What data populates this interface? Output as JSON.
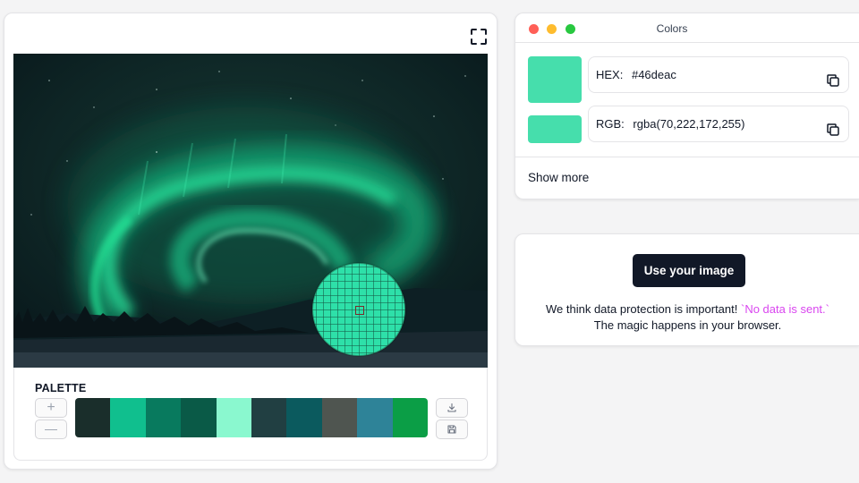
{
  "palette": {
    "title": "PALETTE",
    "add_label": "+",
    "remove_label": "—",
    "swatches": [
      "#1a2e2b",
      "#10bf8e",
      "#087a5e",
      "#0a5a47",
      "#8af8cf",
      "#213f42",
      "#0b5a5e",
      "#4f5550",
      "#2e8398",
      "#0b9e46"
    ],
    "download_icon": "download-icon",
    "save_icon": "floppy-disk-icon"
  },
  "image": {
    "magnifier_color": "#2ee0a9"
  },
  "colors_window": {
    "title": "Colors",
    "selected_color": "#46deac",
    "hex": {
      "label": "HEX:",
      "value": "#46deac"
    },
    "rgb": {
      "label": "RGB:",
      "value": "rgba(70,222,172,255)"
    },
    "show_more": "Show more"
  },
  "upload": {
    "button_label": "Use your image",
    "privacy_text": "We think data protection is important!",
    "privacy_highlight": "`No data is sent.`",
    "privacy_line2": "The magic happens in your browser."
  }
}
